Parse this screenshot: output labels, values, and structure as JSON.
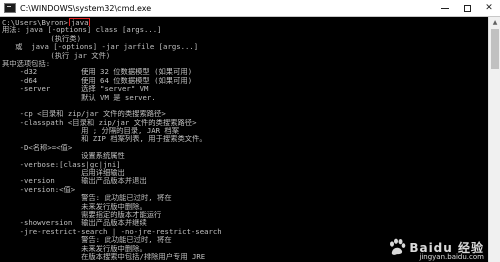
{
  "window": {
    "title": "C:\\WINDOWS\\system32\\cmd.exe",
    "minimize_label": "—",
    "maximize_label": "☐",
    "close_label": "✕"
  },
  "console": {
    "prompt_path": "C:\\Users\\Byron>",
    "command": "java",
    "lines": [
      "用法: java [-options] class [args...]",
      "           (执行类)",
      "   或  java [-options] -jar jarfile [args...]",
      "           (执行 jar 文件)",
      "其中选项包括:",
      "    -d32          使用 32 位数据模型 (如果可用)",
      "    -d64          使用 64 位数据模型 (如果可用)",
      "    -server       选择 \"server\" VM",
      "                  默认 VM 是 server.",
      "",
      "    -cp <目录和 zip/jar 文件的类搜索路径>",
      "    -classpath <目录和 zip/jar 文件的类搜索路径>",
      "                  用 ; 分隔的目录, JAR 档案",
      "                  和 ZIP 档案列表, 用于搜索类文件。",
      "    -D<名称>=<值>",
      "                  设置系统属性",
      "    -verbose:[class|gc|jni]",
      "                  启用详细输出",
      "    -version      输出产品版本并退出",
      "    -version:<值>",
      "                  警告: 此功能已过时, 将在",
      "                  未来发行版中删除。",
      "                  需要指定的版本才能运行",
      "    -showversion  输出产品版本并继续",
      "    -jre-restrict-search | -no-jre-restrict-search",
      "                  警告: 此功能已过时, 将在",
      "                  未来发行版中删除。",
      "                  在版本搜索中包括/排除用户专用 JRE"
    ]
  },
  "watermark": {
    "brand": "Baidu 经验",
    "url": "jingyan.baidu.com"
  },
  "colors": {
    "console_bg": "#000000",
    "console_text": "#c0c0c0",
    "highlight_border": "#e02020"
  }
}
